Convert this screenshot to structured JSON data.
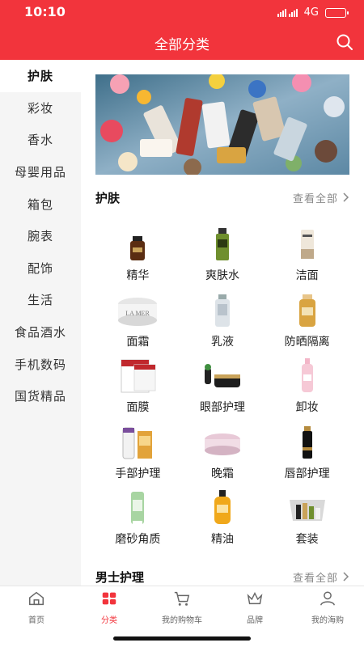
{
  "status_bar": {
    "time": "10:10",
    "network": "4G",
    "battery_level": 0.7
  },
  "header": {
    "title": "全部分类",
    "search_icon": "search-icon"
  },
  "sidebar": {
    "items": [
      {
        "label": "护肤",
        "active": true
      },
      {
        "label": "彩妆",
        "active": false
      },
      {
        "label": "香水",
        "active": false
      },
      {
        "label": "母婴用品",
        "active": false
      },
      {
        "label": "箱包",
        "active": false
      },
      {
        "label": "腕表",
        "active": false
      },
      {
        "label": "配饰",
        "active": false
      },
      {
        "label": "生活",
        "active": false
      },
      {
        "label": "食品酒水",
        "active": false
      },
      {
        "label": "手机数码",
        "active": false
      },
      {
        "label": "国货精品",
        "active": false
      }
    ]
  },
  "main": {
    "sections": [
      {
        "title": "护肤",
        "view_all": "查看全部"
      },
      {
        "title": "男士护理",
        "view_all": "查看全部"
      }
    ],
    "products": [
      {
        "label": "精华",
        "icon": "serum-bottle-icon"
      },
      {
        "label": "爽肤水",
        "icon": "toner-bottle-icon"
      },
      {
        "label": "洁面",
        "icon": "cleanser-tube-icon"
      },
      {
        "label": "面霜",
        "icon": "cream-jar-icon"
      },
      {
        "label": "乳液",
        "icon": "lotion-bottle-icon"
      },
      {
        "label": "防晒隔离",
        "icon": "sunscreen-bottle-icon"
      },
      {
        "label": "面膜",
        "icon": "face-mask-icon"
      },
      {
        "label": "眼部护理",
        "icon": "eye-cream-icon"
      },
      {
        "label": "卸妆",
        "icon": "makeup-remover-icon"
      },
      {
        "label": "手部护理",
        "icon": "hand-cream-icon"
      },
      {
        "label": "晚霜",
        "icon": "night-cream-icon"
      },
      {
        "label": "唇部护理",
        "icon": "lip-care-icon"
      },
      {
        "label": "磨砂角质",
        "icon": "scrub-tube-icon"
      },
      {
        "label": "精油",
        "icon": "essential-oil-icon"
      },
      {
        "label": "套装",
        "icon": "gift-set-icon"
      }
    ]
  },
  "tabbar": {
    "tabs": [
      {
        "label": "首页",
        "icon": "home-icon",
        "active": false
      },
      {
        "label": "分类",
        "icon": "category-icon",
        "active": true
      },
      {
        "label": "我的购物车",
        "icon": "cart-icon",
        "active": false
      },
      {
        "label": "品牌",
        "icon": "crown-icon",
        "active": false
      },
      {
        "label": "我的海购",
        "icon": "user-icon",
        "active": false
      }
    ]
  },
  "colors": {
    "brand": "#f2343c",
    "sidebar_bg": "#f5f5f5",
    "text": "#222222",
    "muted": "#888888"
  }
}
